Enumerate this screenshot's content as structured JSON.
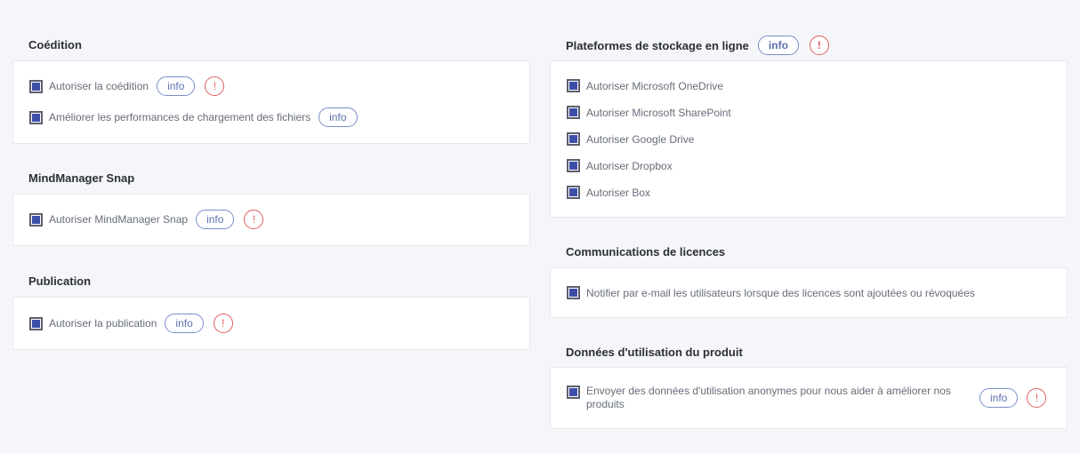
{
  "left": {
    "coedition": {
      "title": "Coédition",
      "items": [
        {
          "label": "Autoriser la coédition",
          "info": "info",
          "warn": "!"
        },
        {
          "label": "Améliorer les performances de chargement des fichiers",
          "info": "info"
        }
      ]
    },
    "snap": {
      "title": "MindManager Snap",
      "items": [
        {
          "label": "Autoriser MindManager Snap",
          "info": "info",
          "warn": "!"
        }
      ]
    },
    "publication": {
      "title": "Publication",
      "items": [
        {
          "label": "Autoriser la publication",
          "info": "info",
          "warn": "!"
        }
      ]
    }
  },
  "right": {
    "storage": {
      "title": "Plateformes de stockage en ligne",
      "info": "info",
      "warn": "!",
      "items": [
        {
          "label": "Autoriser Microsoft OneDrive"
        },
        {
          "label": "Autoriser Microsoft SharePoint"
        },
        {
          "label": "Autoriser Google Drive"
        },
        {
          "label": "Autoriser Dropbox"
        },
        {
          "label": "Autoriser Box"
        }
      ]
    },
    "licences": {
      "title": "Communications de licences",
      "items": [
        {
          "label": "Notifier par e-mail les utilisateurs lorsque des licences sont ajoutées ou révoquées"
        }
      ]
    },
    "usage": {
      "title": "Données d'utilisation du produit",
      "items": [
        {
          "label": "Envoyer des données d'utilisation anonymes pour nous aider à améliorer nos produits",
          "info": "info",
          "warn": "!"
        }
      ]
    }
  },
  "colors": {
    "checkbox": "#3d4ea8",
    "pill_border": "#7b8ec6",
    "warning": "#e05d5d"
  }
}
